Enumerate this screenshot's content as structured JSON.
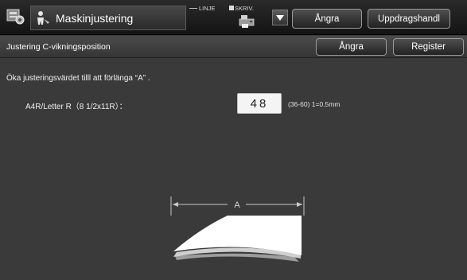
{
  "header": {
    "title": "Maskinjustering",
    "linje_label": "LINJE",
    "skriv_label": "SKRIV.",
    "undo_button": "Ångra",
    "job_button": "Uppdragshandl"
  },
  "subheader": {
    "title": "Justering C-vikningsposition",
    "undo_button": "Ångra",
    "register_button": "Register"
  },
  "content": {
    "instruction": "Öka justeringsvärdet tilll att förlänga “A” .",
    "setting_label": "A4R/Letter R（8 1/2x11R）：",
    "value": "48",
    "range": "(36-60) 1=0.5mm",
    "diagram_label": "A"
  },
  "icons": {
    "app": "machine-settings-icon",
    "title": "person-adjust-icon",
    "printer": "printer-icon",
    "dropdown": "triangle-down-icon"
  },
  "colors": {
    "background": "#3a3a3a",
    "value_box": "#f4f4f4"
  }
}
